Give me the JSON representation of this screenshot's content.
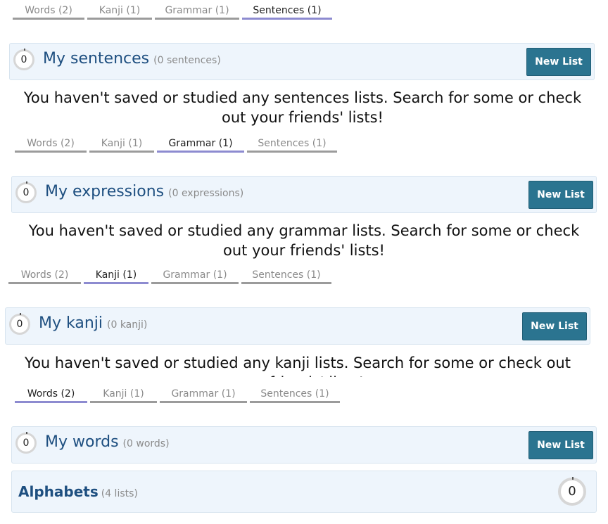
{
  "tabs": {
    "words": "Words (2)",
    "kanji": "Kanji (1)",
    "grammar": "Grammar (1)",
    "sentences": "Sentences (1)"
  },
  "sentences_section": {
    "counter": "0",
    "title": "My sentences",
    "count": "(0 sentences)",
    "button": "New List",
    "message": "You haven't saved or studied any sentences lists. Search for some or check out your friends' lists!"
  },
  "grammar_section": {
    "counter": "0",
    "title": "My expressions",
    "count": "(0 expressions)",
    "button": "New List",
    "message": "You haven't saved or studied any grammar lists. Search for some or check out your friends' lists!"
  },
  "kanji_section": {
    "counter": "0",
    "title": "My kanji",
    "count": "(0 kanji)",
    "button": "New List",
    "message": "You haven't saved or studied any kanji lists. Search for some or check out your friends' lists!"
  },
  "words_section": {
    "counter": "0",
    "title": "My words",
    "count": "(0 words)",
    "button": "New List"
  },
  "alphabets": {
    "title": "Alphabets",
    "count": "(4 lists)",
    "counter": "0"
  },
  "colors": {
    "accent": "#2b7490",
    "title": "#1e4f80",
    "active_tab": "#8d8bd0",
    "panel_bg": "#eef5fc"
  }
}
